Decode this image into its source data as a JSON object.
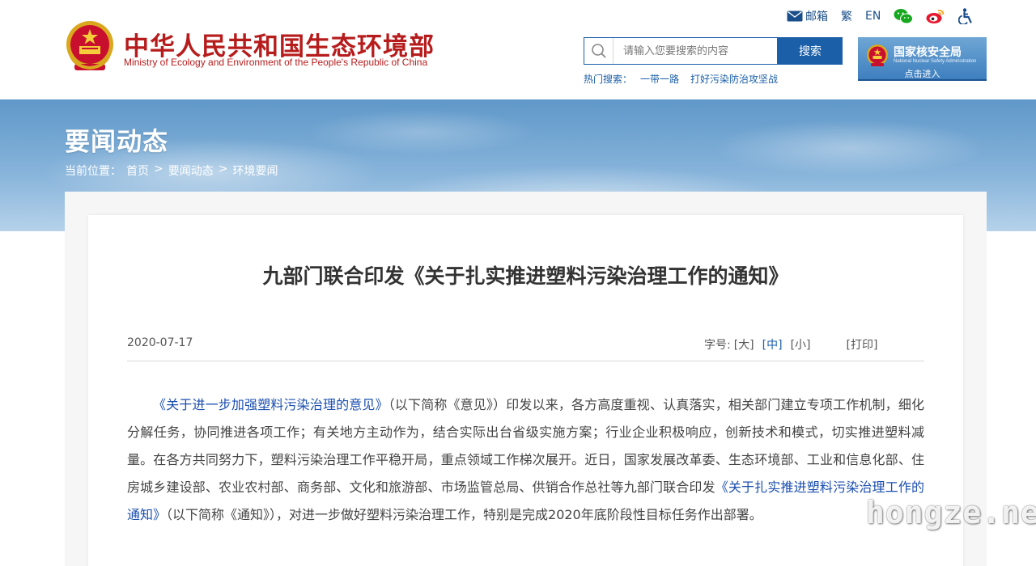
{
  "header": {
    "site_name_cn": "中华人民共和国生态环境部",
    "site_name_en": "Ministry of Ecology and Environment of the People's Republic of China",
    "top_links": {
      "mail": "邮箱",
      "traditional": "繁",
      "english": "EN"
    },
    "icons": [
      "mail-icon",
      "wechat-icon",
      "weibo-icon",
      "accessibility-icon",
      "search-icon",
      "national-emblem-icon"
    ],
    "search": {
      "placeholder": "请输入您要搜索的内容",
      "button": "搜索"
    },
    "hot_search": {
      "label": "热门搜索：",
      "items": [
        "一带一路",
        "打好污染防治攻坚战"
      ]
    },
    "nnsa": {
      "title": "国家核安全局",
      "subtitle": "National Nuclear Safety Administration",
      "enter": "点击进入"
    },
    "colors": {
      "brand_red": "#b71c1c",
      "brand_blue": "#1b5fa8"
    }
  },
  "banner": {
    "title": "要闻动态",
    "breadcrumb": {
      "label": "当前位置：",
      "items": [
        "首页",
        "要闻动态",
        "环境要闻"
      ],
      "separator": ">"
    }
  },
  "article": {
    "title": "九部门联合印发《关于扎实推进塑料污染治理工作的通知》",
    "date": "2020-07-17",
    "font_size": {
      "label": "字号:",
      "large": "[大]",
      "medium": "[中]",
      "small": "[小]"
    },
    "print": "[打印]",
    "paragraph": {
      "link1": "《关于进一步加强塑料污染治理的意见》",
      "part1": "（以下简称《意见》）印发以来，各方高度重视、认真落实，相关部门建立专项工作机制，细化分解任务，协同推进各项工作；有关地方主动作为，结合实际出台省级实施方案；行业企业积极响应，创新技术和模式，切实推进塑料减量。在各方共同努力下，塑料污染治理工作平稳开局，重点领域工作梯次展开。近日，国家发展改革委、生态环境部、工业和信息化部、住房城乡建设部、农业农村部、商务部、文化和旅游部、市场监管总局、供销合作总社等九部门联合印发",
      "link2": "《关于扎实推进塑料污染治理工作的通知》",
      "part2": "（以下简称《通知》），对进一步做好塑料污染治理工作，特别是完成2020年底阶段性目标任务作出部署。"
    }
  },
  "watermark": "hongze.net"
}
